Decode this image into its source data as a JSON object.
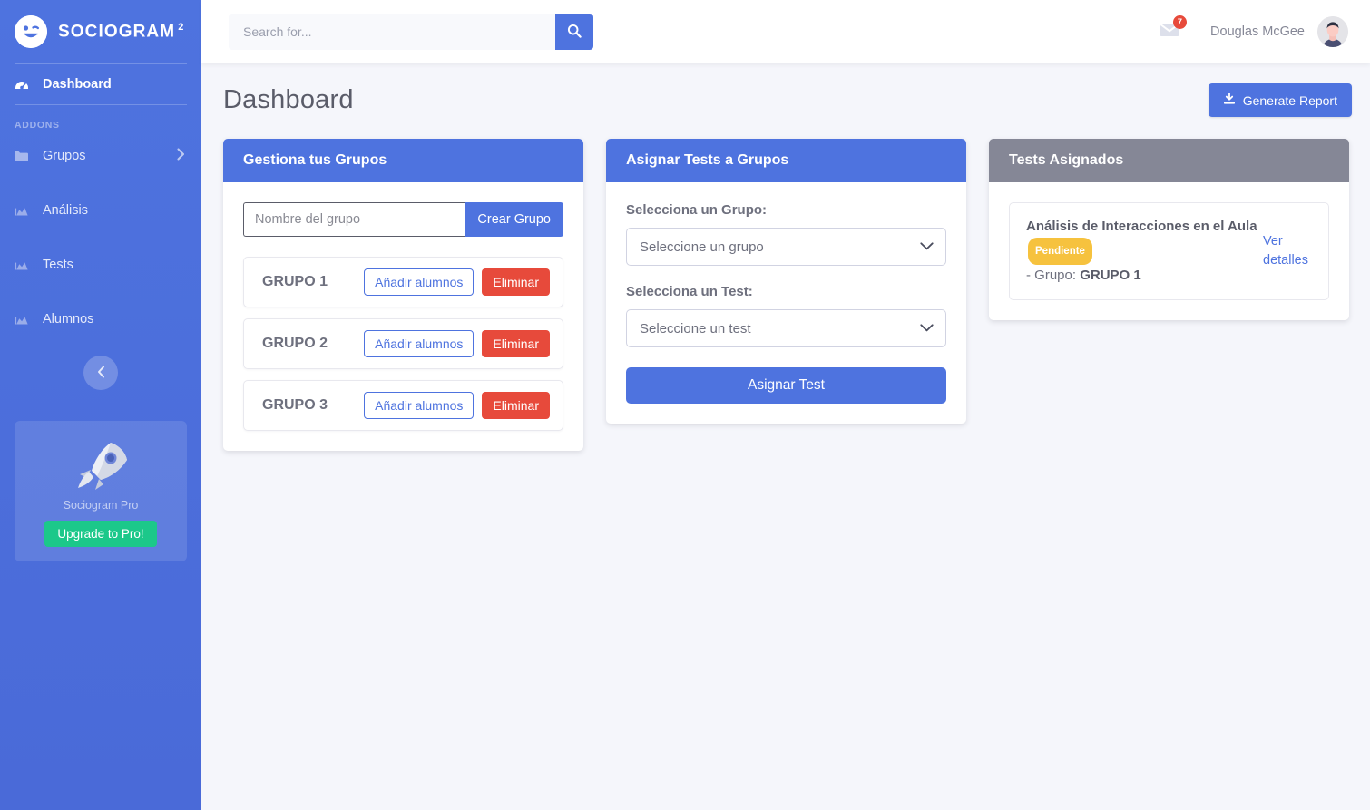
{
  "brand": {
    "name": "SOCIOGRAM",
    "superscript": "2",
    "logo_icon": "winking-face-icon"
  },
  "sidebar": {
    "addons_label": "ADDONS",
    "primary": [
      {
        "label": "Dashboard",
        "icon": "tachometer-icon",
        "active": true
      }
    ],
    "items": [
      {
        "label": "Grupos",
        "icon": "folder-icon",
        "chevron": "chevron-right-icon"
      },
      {
        "label": "Análisis",
        "icon": "chart-area-icon"
      },
      {
        "label": "Tests",
        "icon": "chart-area-icon"
      },
      {
        "label": "Alumnos",
        "icon": "chart-area-icon"
      }
    ],
    "collapse_icon": "chevron-left-icon",
    "pro": {
      "icon": "rocket-icon",
      "title": "Sociogram Pro",
      "button_label": "Upgrade to Pro!",
      "button_color": "#1cc88a"
    }
  },
  "topbar": {
    "search": {
      "placeholder": "Search for...",
      "value": "",
      "button_icon": "search-icon"
    },
    "mail": {
      "icon": "envelope-icon",
      "badge_count": "7",
      "badge_color": "#e74a3b"
    },
    "user": {
      "name": "Douglas McGee",
      "avatar_icon": "user-avatar"
    }
  },
  "page": {
    "title": "Dashboard",
    "generate_report": {
      "label": "Generate Report",
      "icon": "download-icon"
    }
  },
  "cards": {
    "groups": {
      "header": "Gestiona tus Grupos",
      "header_color": "#4e73df",
      "create_input_placeholder": "Nombre del grupo",
      "create_input_value": "",
      "create_button": "Crear Grupo",
      "rows": [
        {
          "name": "GRUPO 1",
          "add": "Añadir alumnos",
          "delete": "Eliminar"
        },
        {
          "name": "GRUPO 2",
          "add": "Añadir alumnos",
          "delete": "Eliminar"
        },
        {
          "name": "GRUPO 3",
          "add": "Añadir alumnos",
          "delete": "Eliminar"
        }
      ]
    },
    "assign": {
      "header": "Asignar Tests a Grupos",
      "header_color": "#4e73df",
      "group_label": "Selecciona un Grupo:",
      "group_select_value": "Seleccione un grupo",
      "test_label": "Selecciona un Test:",
      "test_select_value": "Seleccione un test",
      "submit_label": "Asignar Test"
    },
    "assigned": {
      "header": "Tests Asignados",
      "header_color": "#858796",
      "items": [
        {
          "test_name": "Análisis de Interacciones en el Aula",
          "status": "Pendiente",
          "status_color": "#f6c23e",
          "group_prefix": "- Grupo:",
          "group_name": "GRUPO 1",
          "link_label": "Ver detalles"
        }
      ]
    }
  }
}
